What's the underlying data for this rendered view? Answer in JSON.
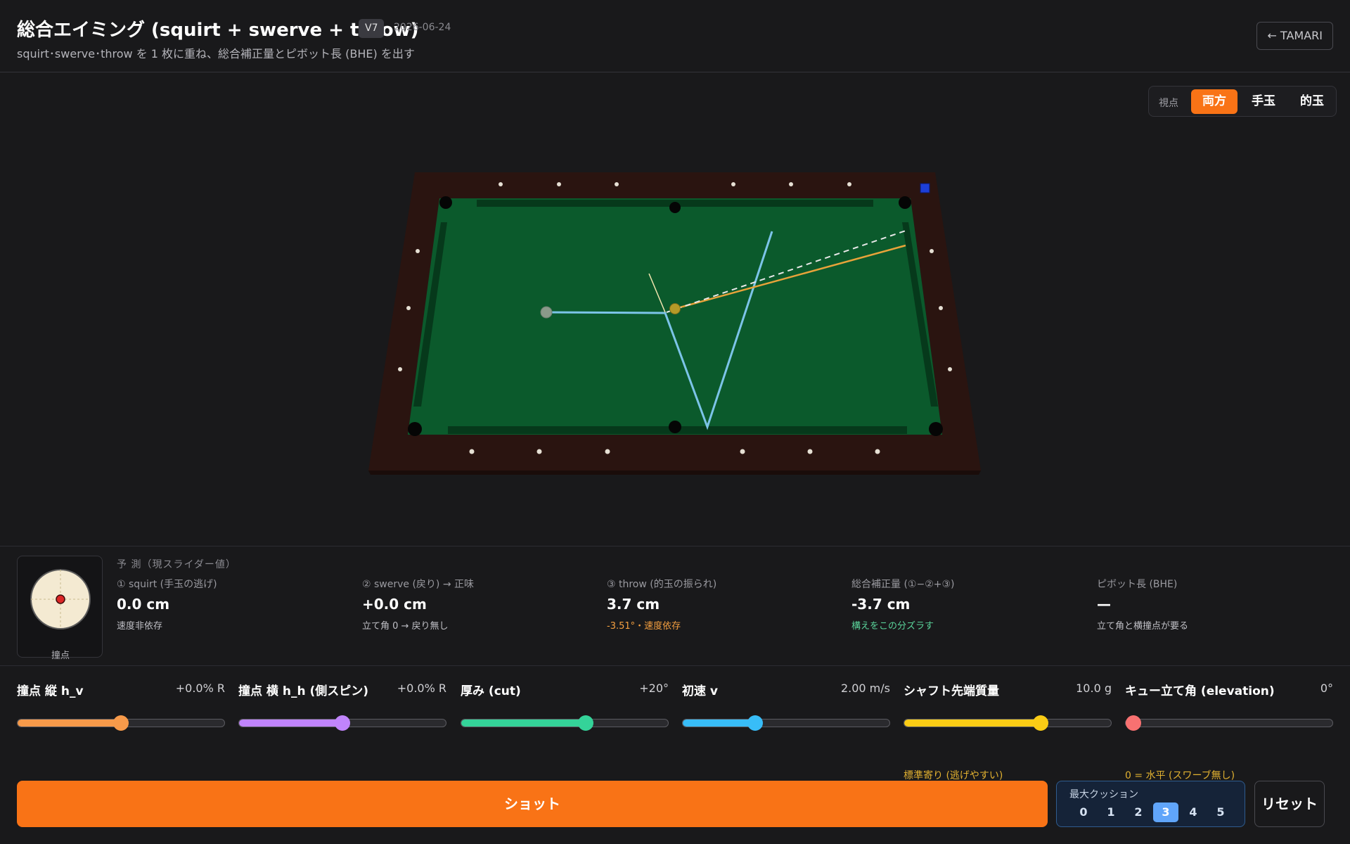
{
  "header": {
    "title": "総合エイミング (squirt + swerve + throw)",
    "version": "V7",
    "date": "2026-06-24",
    "subtitle": "squirt･swerve･throw を 1 枚に重ね、総合補正量とピボット長 (BHE) を出す",
    "back_label": "← TAMARI"
  },
  "viewpoint": {
    "label": "視点",
    "options": [
      "両方",
      "手玉",
      "的玉"
    ],
    "selected": "両方"
  },
  "colors": {
    "accent": "#f97316",
    "felt": "#0b5a2c",
    "rail": "#2a1410",
    "path_cue": "#7cc4e8",
    "path_object": "#e8a33a",
    "positive_note": "#5ad39a",
    "warning_note": "#f5a040"
  },
  "prediction": {
    "heading": "予 測（現スライダー値）",
    "contact_caption": "撞点",
    "metrics": [
      {
        "label": "① squirt (手玉の逃げ)",
        "value": "0.0 cm",
        "note": "速度非依存",
        "note_color": "#c0c0c6"
      },
      {
        "label": "② swerve (戻り) → 正味",
        "value": "+0.0 cm",
        "note": "立て角 0 → 戻り無し",
        "note_color": "#c0c0c6"
      },
      {
        "label": "③ throw (的玉の振られ)",
        "value": "3.7 cm",
        "note": "-3.51°・速度依存",
        "note_color": "#f5a040"
      },
      {
        "label": "総合補正量 (①−②+③)",
        "value": "-3.7 cm",
        "note": "構えをこの分ズラす",
        "note_color": "#5ad39a"
      },
      {
        "label": "ピボット長 (BHE)",
        "value": "—",
        "note": "立て角と横撞点が要る",
        "note_color": "#c0c0c6"
      }
    ]
  },
  "sliders": [
    {
      "name": "撞点 縦 h_v",
      "value": "+0.0% R",
      "fraction": 0.5,
      "color": "#f79a4a",
      "hint": ""
    },
    {
      "name": "撞点 横 h_h (側スピン)",
      "value": "+0.0% R",
      "fraction": 0.5,
      "color": "#c084fc",
      "hint": ""
    },
    {
      "name": "厚み (cut)",
      "value": "+20°",
      "fraction": 0.6,
      "color": "#34d399",
      "hint": ""
    },
    {
      "name": "初速 v",
      "value": "2.00 m/s",
      "fraction": 0.35,
      "color": "#38bdf8",
      "hint": ""
    },
    {
      "name": "シャフト先端質量",
      "value": "10.0 g",
      "fraction": 0.66,
      "color": "#facc15",
      "hint": "標準寄り (逃げやすい)"
    },
    {
      "name": "キュー立て角 (elevation)",
      "value": "0°",
      "fraction": 0.04,
      "color": "#f87171",
      "hint": "0 = 水平 (スワーブ無し)"
    }
  ],
  "actions": {
    "shot_label": "ショット",
    "cushion_label": "最大クッション",
    "cushion_options": [
      "0",
      "1",
      "2",
      "3",
      "4",
      "5"
    ],
    "cushion_selected": "3",
    "reset_label": "リセット"
  }
}
